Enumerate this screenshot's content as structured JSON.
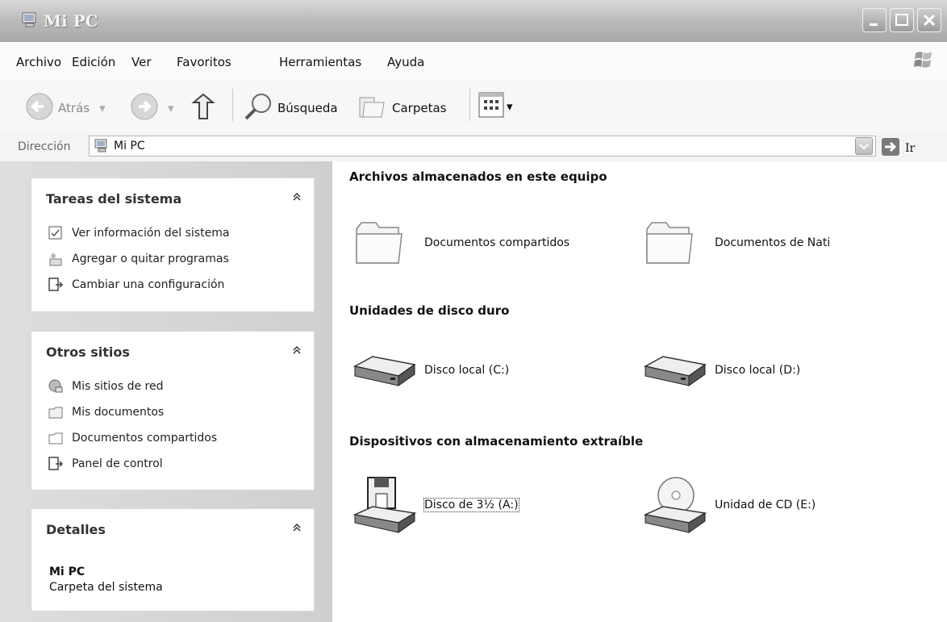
{
  "window": {
    "title": "Mi PC"
  },
  "menu": [
    "Archivo",
    "Edición",
    "Ver",
    "Favoritos",
    "Herramientas",
    "Ayuda"
  ],
  "toolbar": {
    "back": "Atrás",
    "search": "Búsqueda",
    "folders": "Carpetas"
  },
  "address": {
    "label": "Dirección",
    "value": "Mi PC",
    "go": "Ir"
  },
  "left": {
    "system_tasks": {
      "title": "Tareas del sistema",
      "items": [
        "Ver información del sistema",
        "Agregar o quitar programas",
        "Cambiar una configuración"
      ]
    },
    "other_places": {
      "title": "Otros sitios",
      "items": [
        "Mis sitios de red",
        "Mis documentos",
        "Documentos compartidos",
        "Panel de control"
      ]
    },
    "details": {
      "title": "Detalles",
      "name": "Mi PC",
      "type": "Carpeta del sistema"
    }
  },
  "main": {
    "sections": [
      {
        "title": "Archivos almacenados en este equipo",
        "items": [
          "Documentos compartidos",
          "Documentos de Nati"
        ]
      },
      {
        "title": "Unidades de disco duro",
        "items": [
          "Disco local (C:)",
          "Disco local (D:)"
        ]
      },
      {
        "title": "Dispositivos con almacenamiento extraíble",
        "items": [
          "Disco de 3½ (A:)",
          "Unidad de CD (E:)"
        ]
      }
    ]
  }
}
